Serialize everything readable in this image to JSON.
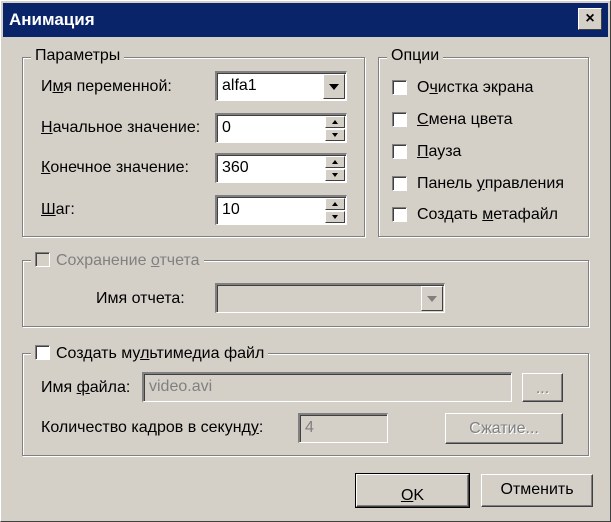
{
  "window": {
    "title": "Анимация",
    "close_symbol": "×"
  },
  "params": {
    "legend": "Параметры",
    "var_name": {
      "pre": "И",
      "acc": "м",
      "post": "я переменной:",
      "value": "alfa1"
    },
    "start": {
      "acc": "Н",
      "post": "ачальное значение:",
      "value": "0"
    },
    "end": {
      "acc": "К",
      "post": "онечное значение:",
      "value": "360"
    },
    "step": {
      "acc": "Ш",
      "post": "аг:",
      "value": "10"
    }
  },
  "options": {
    "legend": "Опции",
    "items": [
      {
        "pre": "О",
        "acc": "ч",
        "post": "истка экрана",
        "checked": false
      },
      {
        "pre": "",
        "acc": "С",
        "post": "мена цвета",
        "checked": false
      },
      {
        "pre": "",
        "acc": "П",
        "post": "ауза",
        "checked": false
      },
      {
        "pre": "Панель ",
        "acc": "у",
        "post": "правления",
        "checked": false
      },
      {
        "pre": "Создать ",
        "acc": "м",
        "post": "етафайл",
        "checked": false
      }
    ]
  },
  "report": {
    "checkbox_pre": "Сохранение ",
    "checkbox_acc": "о",
    "checkbox_post": "тчета",
    "name_label": "Имя отчета:",
    "name_value": "",
    "enabled": false
  },
  "multimedia": {
    "checkbox_pre": "Создать му",
    "checkbox_acc": "л",
    "checkbox_post": "ьтимедиа файл",
    "checked": false,
    "file_label_pre": "Имя ",
    "file_label_acc": "ф",
    "file_label_post": "айла:",
    "file_value": "video.avi",
    "browse_label": "...",
    "fps_label_pre": "Количество кадров в секунд",
    "fps_label_acc": "у",
    "fps_label_post": ":",
    "fps_value": "4",
    "compress_label": "Сжатие..."
  },
  "buttons": {
    "ok_acc": "O",
    "ok_post": "K",
    "cancel": "Отменить"
  }
}
